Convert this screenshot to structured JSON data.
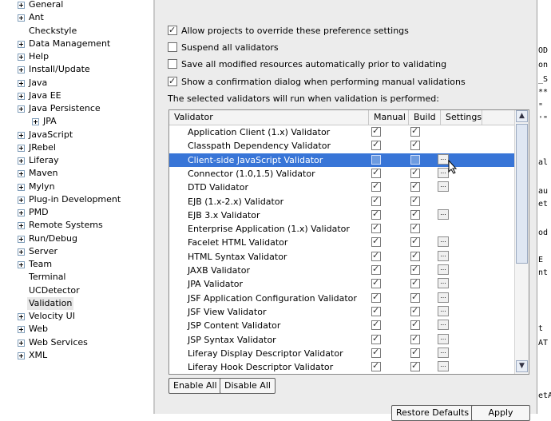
{
  "tree": [
    {
      "label": "General",
      "exp": true,
      "indent": 0
    },
    {
      "label": "Ant",
      "exp": true,
      "indent": 0
    },
    {
      "label": "Checkstyle",
      "exp": false,
      "indent": 0
    },
    {
      "label": "Data Management",
      "exp": true,
      "indent": 0
    },
    {
      "label": "Help",
      "exp": true,
      "indent": 0
    },
    {
      "label": "Install/Update",
      "exp": true,
      "indent": 0
    },
    {
      "label": "Java",
      "exp": true,
      "indent": 0
    },
    {
      "label": "Java EE",
      "exp": true,
      "indent": 0
    },
    {
      "label": "Java Persistence",
      "exp": true,
      "indent": 0
    },
    {
      "label": "JPA",
      "exp": true,
      "indent": 1
    },
    {
      "label": "JavaScript",
      "exp": true,
      "indent": 0
    },
    {
      "label": "JRebel",
      "exp": true,
      "indent": 0
    },
    {
      "label": "Liferay",
      "exp": true,
      "indent": 0
    },
    {
      "label": "Maven",
      "exp": true,
      "indent": 0
    },
    {
      "label": "Mylyn",
      "exp": true,
      "indent": 0
    },
    {
      "label": "Plug-in Development",
      "exp": true,
      "indent": 0
    },
    {
      "label": "PMD",
      "exp": true,
      "indent": 0
    },
    {
      "label": "Remote Systems",
      "exp": true,
      "indent": 0
    },
    {
      "label": "Run/Debug",
      "exp": true,
      "indent": 0
    },
    {
      "label": "Server",
      "exp": true,
      "indent": 0
    },
    {
      "label": "Team",
      "exp": true,
      "indent": 0
    },
    {
      "label": "Terminal",
      "exp": false,
      "indent": 0
    },
    {
      "label": "UCDetector",
      "exp": false,
      "indent": 0
    },
    {
      "label": "Validation",
      "exp": false,
      "indent": 0,
      "selected": true
    },
    {
      "label": "Velocity UI",
      "exp": true,
      "indent": 0
    },
    {
      "label": "Web",
      "exp": true,
      "indent": 0
    },
    {
      "label": "Web Services",
      "exp": true,
      "indent": 0
    },
    {
      "label": "XML",
      "exp": true,
      "indent": 0
    }
  ],
  "options": [
    {
      "label": "Allow projects to override these preference settings",
      "checked": true
    },
    {
      "label": "Suspend all validators",
      "checked": false
    },
    {
      "label": "Save all modified resources automatically prior to validating",
      "checked": false
    },
    {
      "label": "Show a confirmation dialog when performing manual validations",
      "checked": true
    }
  ],
  "info_text": "The selected validators will run when validation is performed:",
  "columns": {
    "validator": "Validator",
    "manual": "Manual",
    "build": "Build",
    "settings": "Settings"
  },
  "validators": [
    {
      "name": "Application Client (1.x) Validator",
      "manual": true,
      "build": true,
      "settings": false
    },
    {
      "name": "Classpath Dependency Validator",
      "manual": true,
      "build": true,
      "settings": false
    },
    {
      "name": "Client-side JavaScript Validator",
      "manual": false,
      "build": false,
      "settings": true,
      "selected": true
    },
    {
      "name": "Connector (1.0,1.5) Validator",
      "manual": true,
      "build": true,
      "settings": true
    },
    {
      "name": "DTD Validator",
      "manual": true,
      "build": true,
      "settings": true
    },
    {
      "name": "EJB (1.x-2.x) Validator",
      "manual": true,
      "build": true,
      "settings": false
    },
    {
      "name": "EJB 3.x Validator",
      "manual": true,
      "build": true,
      "settings": true
    },
    {
      "name": "Enterprise Application (1.x) Validator",
      "manual": true,
      "build": true,
      "settings": false
    },
    {
      "name": "Facelet HTML Validator",
      "manual": true,
      "build": true,
      "settings": true
    },
    {
      "name": "HTML Syntax Validator",
      "manual": true,
      "build": true,
      "settings": true
    },
    {
      "name": "JAXB Validator",
      "manual": true,
      "build": true,
      "settings": true
    },
    {
      "name": "JPA Validator",
      "manual": true,
      "build": true,
      "settings": true
    },
    {
      "name": "JSF Application Configuration Validator",
      "manual": true,
      "build": true,
      "settings": true
    },
    {
      "name": "JSF View Validator",
      "manual": true,
      "build": true,
      "settings": true
    },
    {
      "name": "JSP Content Validator",
      "manual": true,
      "build": true,
      "settings": true
    },
    {
      "name": "JSP Syntax Validator",
      "manual": true,
      "build": true,
      "settings": true
    },
    {
      "name": "Liferay Display Descriptor Validator",
      "manual": true,
      "build": true,
      "settings": true
    },
    {
      "name": "Liferay Hook Descriptor Validator",
      "manual": true,
      "build": true,
      "settings": true
    }
  ],
  "settings_button_label": "...",
  "buttons": {
    "enable_all": "Enable All",
    "disable_all": "Disable All",
    "restore_defaults": "Restore Defaults",
    "apply": "Apply"
  },
  "editor_fragments": [
    "OD",
    "on",
    "_S",
    "**",
    "\"",
    "'\"",
    "al",
    "au",
    "et",
    "od",
    "E",
    "nt",
    "t",
    "AT",
    "etA"
  ]
}
